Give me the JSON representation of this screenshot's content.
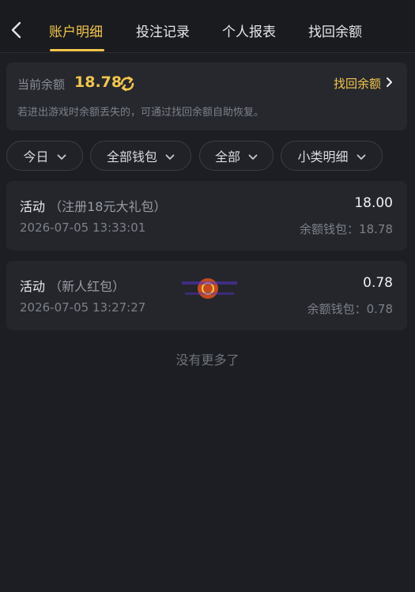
{
  "tabs": [
    {
      "label": "账户明细",
      "active": true
    },
    {
      "label": "投注记录",
      "active": false
    },
    {
      "label": "个人报表",
      "active": false
    },
    {
      "label": "找回余额",
      "active": false
    }
  ],
  "balance": {
    "label": "当前余额",
    "value": "18.78",
    "recover_label": "找回余额",
    "hint": "若进出游戏时余额丢失的，可通过找回余额自助恢复。"
  },
  "filters": [
    {
      "label": "今日"
    },
    {
      "label": "全部钱包"
    },
    {
      "label": "全部"
    },
    {
      "label": "小类明细"
    }
  ],
  "records": [
    {
      "type": "活动",
      "detail": "（注册18元大礼包）",
      "amount": "18.00",
      "time": "2026-07-05 13:33:01",
      "balance": "余额钱包：18.78"
    },
    {
      "type": "活动",
      "detail": "（新人红包）",
      "amount": "0.78",
      "time": "2026-07-05 13:27:27",
      "balance": "余额钱包：0.78"
    }
  ],
  "no_more": "没有更多了",
  "colors": {
    "accent": "#f3c64b",
    "background": "#1c1e23",
    "card": "#26282e"
  },
  "icons": {
    "back": "chevron-left-icon",
    "refresh": "refresh-icon",
    "arrow": "chevron-right-icon",
    "dropdown": "chevron-down-icon"
  }
}
